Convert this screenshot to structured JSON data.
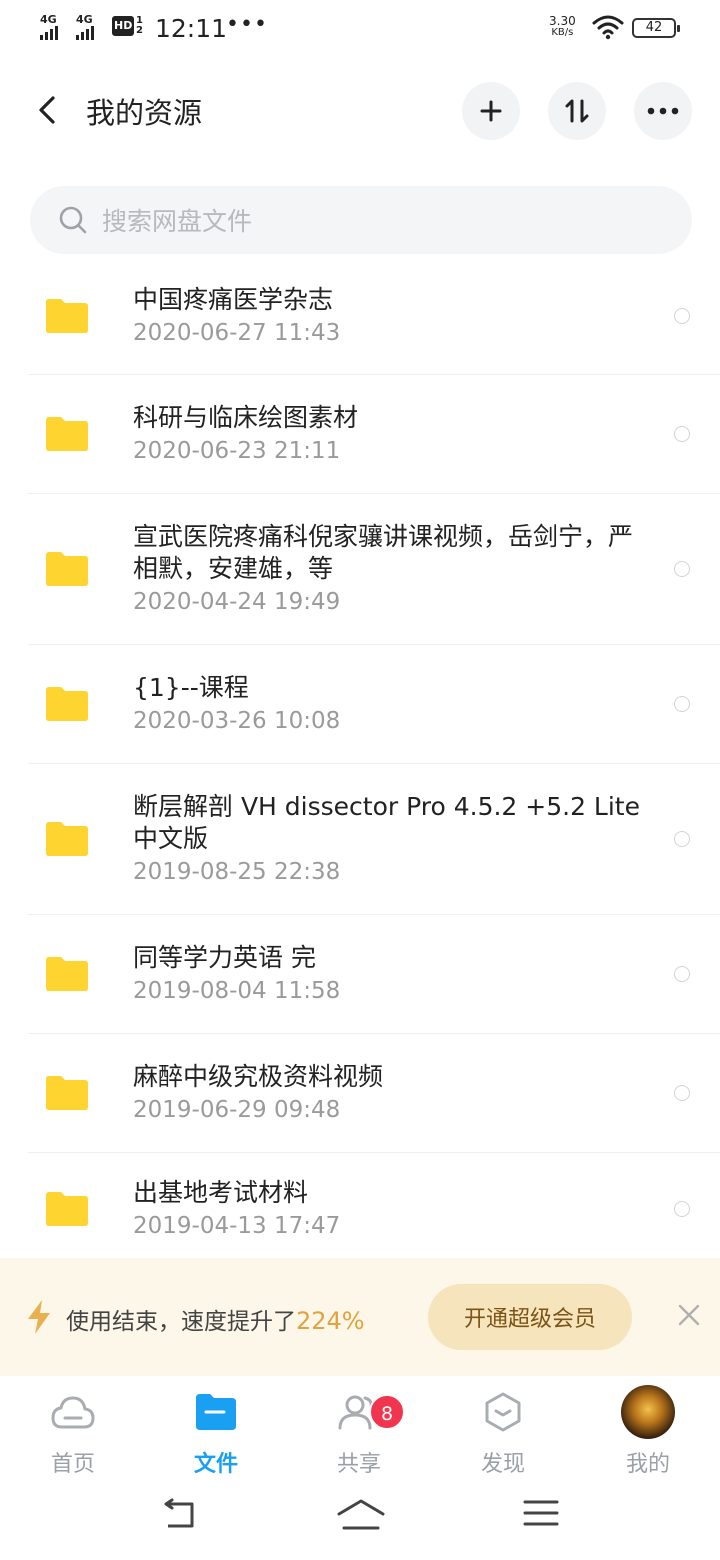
{
  "status_bar": {
    "sim1": "4G",
    "sim2": "4G",
    "hd": "HD",
    "hd_sub": "1\n2",
    "time": "12:11",
    "more": "•••",
    "speed_value": "3.30",
    "speed_unit": "KB/s",
    "battery": "42"
  },
  "header": {
    "title": "我的资源",
    "icons": [
      "back-arrow-icon",
      "plus-icon",
      "sort-icon",
      "more-icon"
    ]
  },
  "search": {
    "placeholder": "搜索网盘文件"
  },
  "files": [
    {
      "name": "中国疼痛医学杂志",
      "date": "2020-06-27  11:43"
    },
    {
      "name": "科研与临床绘图素材",
      "date": "2020-06-23  21:11"
    },
    {
      "name": "宣武医院疼痛科倪家骧讲课视频，岳剑宁，严相默，安建雄，等",
      "date": "2020-04-24  19:49"
    },
    {
      "name": "{1}--课程",
      "date": "2020-03-26  10:08"
    },
    {
      "name": "断层解剖 VH dissector Pro 4.5.2 +5.2 Lite 中文版",
      "date": "2019-08-25  22:38"
    },
    {
      "name": "同等学力英语 完",
      "date": "2019-08-04  11:58"
    },
    {
      "name": "麻醉中级究极资料视频",
      "date": "2019-06-29  09:48"
    },
    {
      "name": "出基地考试材料",
      "date": "2019-04-13  17:47"
    }
  ],
  "promo": {
    "text": "使用结束，速度提升了",
    "percent": "224%",
    "cta": "开通超级会员"
  },
  "tabs": [
    {
      "label": "首页",
      "icon": "cloud-icon"
    },
    {
      "label": "文件",
      "icon": "folder-icon"
    },
    {
      "label": "共享",
      "icon": "users-icon",
      "badge": "8"
    },
    {
      "label": "发现",
      "icon": "discover-icon"
    },
    {
      "label": "我的",
      "icon": "avatar"
    }
  ],
  "colors": {
    "accent": "#1aa0f2",
    "folder": "#fdd430",
    "badge": "#f2354e",
    "promo_bg": "#fdf7ea",
    "promo_cta_bg": "#f6e4bd",
    "percent": "#e2a23c"
  }
}
